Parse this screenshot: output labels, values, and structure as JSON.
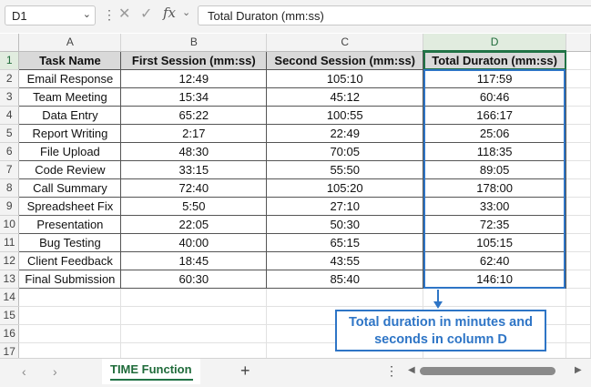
{
  "formula_bar": {
    "name_box": "D1",
    "fx": "fx",
    "formula": "Total Duraton (mm:ss)"
  },
  "columns": [
    "A",
    "B",
    "C",
    "D"
  ],
  "headers": [
    "Task Name",
    "First Session (mm:ss)",
    "Second Session (mm:ss)",
    "Total Duraton (mm:ss)"
  ],
  "rows": [
    [
      "Email Response",
      "12:49",
      "105:10",
      "117:59"
    ],
    [
      "Team Meeting",
      "15:34",
      "45:12",
      "60:46"
    ],
    [
      "Data Entry",
      "65:22",
      "100:55",
      "166:17"
    ],
    [
      "Report Writing",
      "2:17",
      "22:49",
      "25:06"
    ],
    [
      "File Upload",
      "48:30",
      "70:05",
      "118:35"
    ],
    [
      "Code Review",
      "33:15",
      "55:50",
      "89:05"
    ],
    [
      "Call Summary",
      "72:40",
      "105:20",
      "178:00"
    ],
    [
      "Spreadsheet Fix",
      "5:50",
      "27:10",
      "33:00"
    ],
    [
      "Presentation",
      "22:05",
      "50:30",
      "72:35"
    ],
    [
      "Bug Testing",
      "40:00",
      "65:15",
      "105:15"
    ],
    [
      "Client Feedback",
      "18:45",
      "43:55",
      "62:40"
    ],
    [
      "Final Submission",
      "60:30",
      "85:40",
      "146:10"
    ]
  ],
  "row_numbers": [
    "1",
    "2",
    "3",
    "4",
    "5",
    "6",
    "7",
    "8",
    "9",
    "10",
    "11",
    "12",
    "13",
    "14",
    "15",
    "16",
    "17"
  ],
  "callout": {
    "line1": "Total duration in minutes and",
    "line2": "seconds in column D"
  },
  "sheet_tabs": {
    "active": "TIME Function",
    "add": "+"
  },
  "colors": {
    "accent_green": "#217346",
    "callout_blue": "#2e75c6",
    "header_fill": "#d9d9d9"
  },
  "icons": [
    "chevron-down-icon",
    "more-vertical-icon",
    "cancel-icon",
    "check-icon",
    "fx-icon",
    "chevron-left-icon",
    "chevron-right-icon",
    "plus-icon",
    "scroll-left-icon",
    "scroll-right-icon"
  ]
}
